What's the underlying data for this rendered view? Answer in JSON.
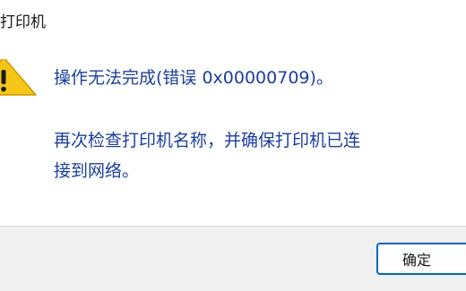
{
  "window": {
    "title": "打印机"
  },
  "message": {
    "icon": "warning-icon",
    "main_instruction": "操作无法完成(错误 0x00000709)。",
    "detail_line1": "再次检查打印机名称，并确保打印机已连",
    "detail_line2": "接到网络。"
  },
  "buttons": {
    "ok_label": "确定"
  },
  "colors": {
    "message_text": "#1c3f9e",
    "warning_fill": "#f5c518",
    "button_border": "#0067c0",
    "footer_bg": "#f0f0f0"
  }
}
